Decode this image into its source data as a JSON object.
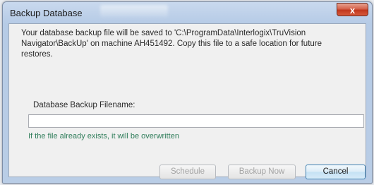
{
  "window": {
    "title": "Backup Database",
    "close_glyph": "x"
  },
  "dialog": {
    "message": "Your database backup file will be saved to 'C:\\ProgramData\\Interlogix\\TruVision Navigator\\BackUp' on machine AH451492. Copy this file to a safe location for future restores.",
    "filename_label": "Database Backup Filename:",
    "filename_value": "",
    "overwrite_note": "If the file already exists, it will be overwritten"
  },
  "buttons": {
    "schedule": "Schedule",
    "backup_now": "Backup Now",
    "cancel": "Cancel"
  },
  "colors": {
    "note_text": "#2f7d5a",
    "close_button": "#c1371d",
    "default_button_border": "#3c7fb1"
  }
}
